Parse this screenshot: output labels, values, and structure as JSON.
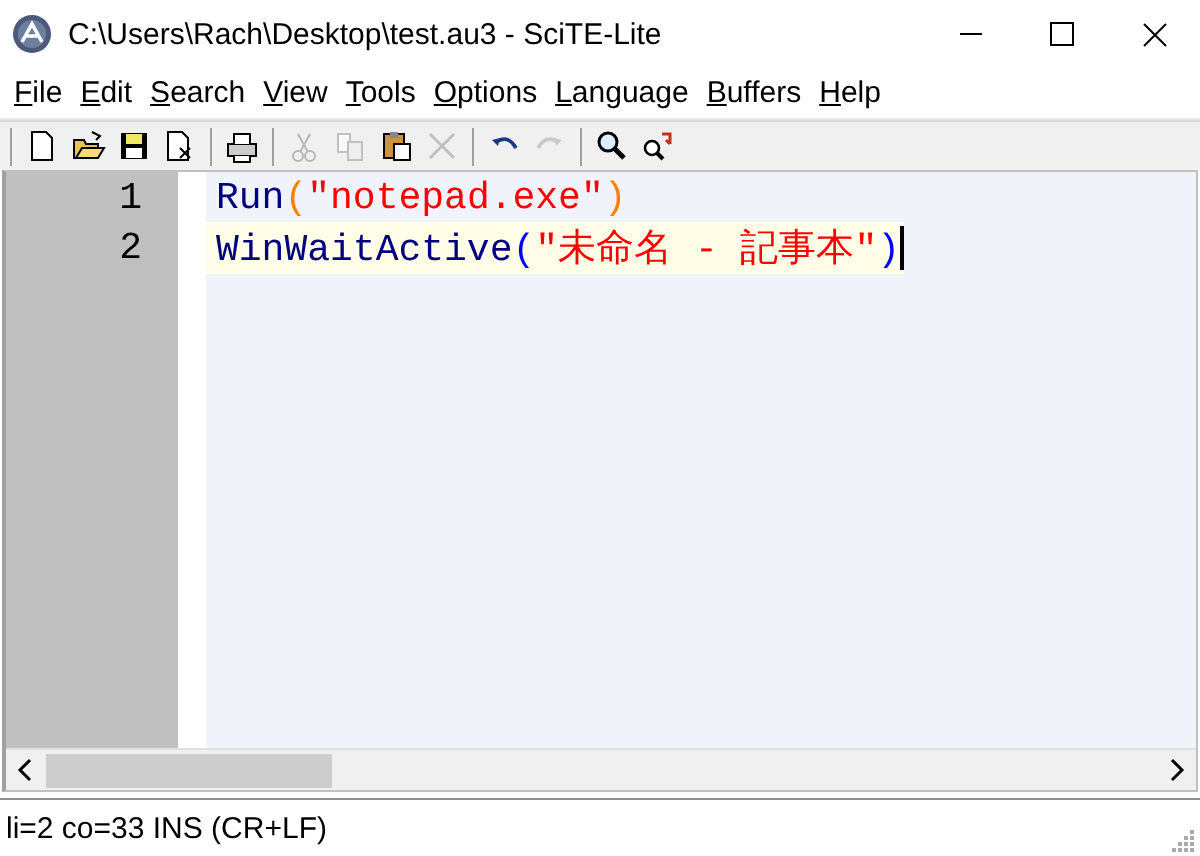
{
  "window": {
    "title": "C:\\Users\\Rach\\Desktop\\test.au3 - SciTE-Lite"
  },
  "menu": [
    {
      "label": "File"
    },
    {
      "label": "Edit"
    },
    {
      "label": "Search"
    },
    {
      "label": "View"
    },
    {
      "label": "Tools"
    },
    {
      "label": "Options"
    },
    {
      "label": "Language"
    },
    {
      "label": "Buffers"
    },
    {
      "label": "Help"
    }
  ],
  "toolbar": [
    {
      "kind": "new",
      "disabled": false
    },
    {
      "kind": "open",
      "disabled": false
    },
    {
      "kind": "save",
      "disabled": false
    },
    {
      "kind": "close",
      "disabled": false
    },
    {
      "kind": "separator"
    },
    {
      "kind": "print",
      "disabled": false
    },
    {
      "kind": "separator"
    },
    {
      "kind": "cut",
      "disabled": true
    },
    {
      "kind": "copy",
      "disabled": true
    },
    {
      "kind": "paste",
      "disabled": false
    },
    {
      "kind": "delete",
      "disabled": true
    },
    {
      "kind": "separator"
    },
    {
      "kind": "undo",
      "disabled": false
    },
    {
      "kind": "redo",
      "disabled": true
    },
    {
      "kind": "separator"
    },
    {
      "kind": "find",
      "disabled": false
    },
    {
      "kind": "replace",
      "disabled": false
    }
  ],
  "editor": {
    "lines": [
      {
        "number": "1",
        "current": false,
        "tokens": [
          {
            "kind": "function",
            "text": "Run"
          },
          {
            "kind": "paren",
            "text": "("
          },
          {
            "kind": "string",
            "text": "\"notepad.exe\""
          },
          {
            "kind": "paren",
            "text": ")"
          }
        ]
      },
      {
        "number": "2",
        "current": true,
        "tokens": [
          {
            "kind": "function",
            "text": "WinWaitActive"
          },
          {
            "kind": "brace-match",
            "text": "("
          },
          {
            "kind": "string",
            "text": "\"未命名 - 記事本\""
          },
          {
            "kind": "brace-match",
            "text": ")"
          }
        ]
      }
    ]
  },
  "status_bar": {
    "text": "li=2 co=33 INS (CR+LF)"
  }
}
